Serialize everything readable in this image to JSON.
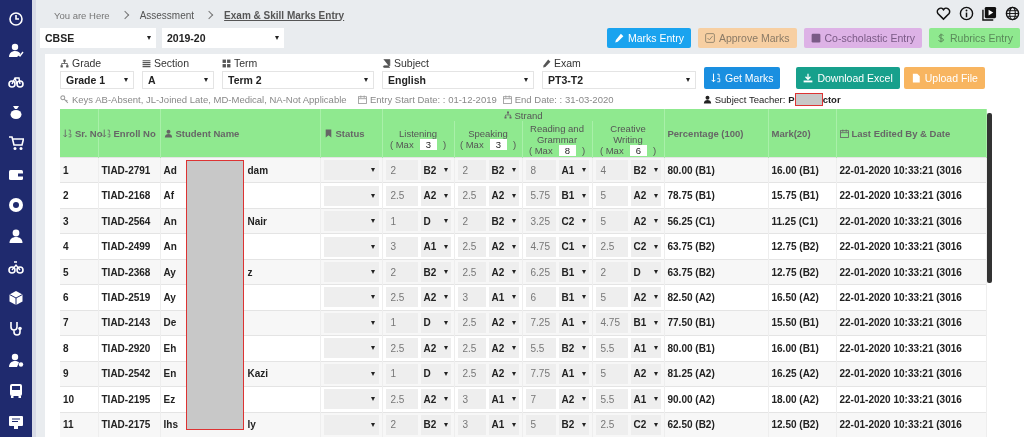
{
  "breadcrumb": {
    "prefix": "You are Here",
    "items": [
      "Assessment",
      "Exam & Skill Marks Entry"
    ]
  },
  "board_select": {
    "value": "CBSE"
  },
  "year_select": {
    "value": "2019-20"
  },
  "action_buttons": [
    {
      "label": "Marks Entry",
      "kind": "primary"
    },
    {
      "label": "Approve Marks",
      "kind": "approve"
    },
    {
      "label": "Co-scholastic Entry",
      "kind": "coscholastic"
    },
    {
      "label": "Rubrics Entry",
      "kind": "rubrics"
    }
  ],
  "filters": [
    {
      "label": "Grade",
      "value": "Grade 1"
    },
    {
      "label": "Section",
      "value": "A"
    },
    {
      "label": "Term",
      "value": "Term 2"
    },
    {
      "label": "Subject",
      "value": "English"
    },
    {
      "label": "Exam",
      "value": "PT3-T2"
    }
  ],
  "form_buttons": [
    {
      "label": "Get Marks",
      "kind": "get"
    },
    {
      "label": "Download Excel",
      "kind": "download"
    },
    {
      "label": "Upload File",
      "kind": "upload"
    }
  ],
  "keys_note": "Keys AB-Absent, JL-Joined Late, MD-Medical, NA-Not Applicable",
  "entry_start": "Entry Start Date: : 01-12-2019",
  "end_date": "End Date: : 31-03-2020",
  "subject_teacher": {
    "label": "Subject Teacher:",
    "name_start": "P",
    "name_end": "ctor"
  },
  "table": {
    "columns": [
      "Sr. No",
      "Enroll No",
      "Student Name",
      "Status",
      "Percentage (100)",
      "Mark(20)",
      "Last Edited By & Date"
    ],
    "strand": {
      "label": "Strand",
      "skills": [
        {
          "label": "Listening",
          "max_prefix": "( Max",
          "max": "3",
          "max_suffix": ")"
        },
        {
          "label": "Speaking",
          "max_prefix": "( Max",
          "max": "3",
          "max_suffix": ")"
        },
        {
          "label": "Reading and Grammar",
          "max_prefix": "( Max",
          "max": "8",
          "max_suffix": ")"
        },
        {
          "label": "Creative Writing",
          "max_prefix": "( Max",
          "max": "6",
          "max_suffix": ")"
        }
      ]
    },
    "rows": [
      {
        "sr": "1",
        "enroll": "TIAD-2791",
        "name_start": "Ad",
        "name_end": "dam",
        "scores": [
          [
            "2",
            "B2"
          ],
          [
            "2",
            "B2"
          ],
          [
            "8",
            "A1"
          ],
          [
            "4",
            "B2"
          ]
        ],
        "percentage": "80.00 (B1)",
        "mark": "16.00 (B1)",
        "edited": "22-01-2020 10:33:21 (3016"
      },
      {
        "sr": "2",
        "enroll": "TIAD-2168",
        "name_start": "Af",
        "name_end": "",
        "scores": [
          [
            "2.5",
            "A2"
          ],
          [
            "2.5",
            "A2"
          ],
          [
            "5.75",
            "B1"
          ],
          [
            "5",
            "A2"
          ]
        ],
        "percentage": "78.75 (B1)",
        "mark": "15.75 (B1)",
        "edited": "22-01-2020 10:33:21 (3016"
      },
      {
        "sr": "3",
        "enroll": "TIAD-2564",
        "name_start": "An",
        "name_end": "Nair",
        "scores": [
          [
            "1",
            "D"
          ],
          [
            "2",
            "B2"
          ],
          [
            "3.25",
            "C2"
          ],
          [
            "5",
            "A2"
          ]
        ],
        "percentage": "56.25 (C1)",
        "mark": "11.25 (C1)",
        "edited": "22-01-2020 10:33:21 (3016"
      },
      {
        "sr": "4",
        "enroll": "TIAD-2499",
        "name_start": "An",
        "name_end": "",
        "scores": [
          [
            "3",
            "A1"
          ],
          [
            "2.5",
            "A2"
          ],
          [
            "4.75",
            "C1"
          ],
          [
            "2.5",
            "C2"
          ]
        ],
        "percentage": "63.75 (B2)",
        "mark": "12.75 (B2)",
        "edited": "22-01-2020 10:33:21 (3016"
      },
      {
        "sr": "5",
        "enroll": "TIAD-2368",
        "name_start": "Ay",
        "name_end": "z",
        "scores": [
          [
            "2",
            "B2"
          ],
          [
            "2.5",
            "A2"
          ],
          [
            "6.25",
            "B1"
          ],
          [
            "2",
            "D"
          ]
        ],
        "percentage": "63.75 (B2)",
        "mark": "12.75 (B2)",
        "edited": "22-01-2020 10:33:21 (3016"
      },
      {
        "sr": "6",
        "enroll": "TIAD-2519",
        "name_start": "Ay",
        "name_end": "",
        "scores": [
          [
            "2.5",
            "A2"
          ],
          [
            "3",
            "A1"
          ],
          [
            "6",
            "B1"
          ],
          [
            "5",
            "A2"
          ]
        ],
        "percentage": "82.50 (A2)",
        "mark": "16.50 (A2)",
        "edited": "22-01-2020 10:33:21 (3016"
      },
      {
        "sr": "7",
        "enroll": "TIAD-2143",
        "name_start": "De",
        "name_end": "",
        "scores": [
          [
            "1",
            "D"
          ],
          [
            "2.5",
            "A2"
          ],
          [
            "7.25",
            "A1"
          ],
          [
            "4.75",
            "B1"
          ]
        ],
        "percentage": "77.50 (B1)",
        "mark": "15.50 (B1)",
        "edited": "22-01-2020 10:33:21 (3016"
      },
      {
        "sr": "8",
        "enroll": "TIAD-2920",
        "name_start": "Eh",
        "name_end": "",
        "scores": [
          [
            "2.5",
            "A2"
          ],
          [
            "2.5",
            "A2"
          ],
          [
            "5.5",
            "B2"
          ],
          [
            "5.5",
            "A1"
          ]
        ],
        "percentage": "80.00 (B1)",
        "mark": "16.00 (B1)",
        "edited": "22-01-2020 10:33:21 (3016"
      },
      {
        "sr": "9",
        "enroll": "TIAD-2542",
        "name_start": "En",
        "name_end": "Kazi",
        "scores": [
          [
            "1",
            "D"
          ],
          [
            "2.5",
            "A2"
          ],
          [
            "7.75",
            "A1"
          ],
          [
            "5",
            "A2"
          ]
        ],
        "percentage": "81.25 (A2)",
        "mark": "16.25 (A2)",
        "edited": "22-01-2020 10:33:21 (3016"
      },
      {
        "sr": "10",
        "enroll": "TIAD-2195",
        "name_start": "Ez",
        "name_end": "",
        "scores": [
          [
            "2.5",
            "A2"
          ],
          [
            "3",
            "A1"
          ],
          [
            "7",
            "A2"
          ],
          [
            "5.5",
            "A1"
          ]
        ],
        "percentage": "90.00 (A2)",
        "mark": "18.00 (A2)",
        "edited": "22-01-2020 10:33:21 (3016"
      },
      {
        "sr": "11",
        "enroll": "TIAD-2175",
        "name_start": "Ihs",
        "name_end": "ly",
        "scores": [
          [
            "2",
            "B2"
          ],
          [
            "3",
            "A1"
          ],
          [
            "5",
            "B2"
          ],
          [
            "2.5",
            "C2"
          ]
        ],
        "percentage": "62.50 (B2)",
        "mark": "12.50 (B2)",
        "edited": "22-01-2020 10:33:21 (3016"
      }
    ]
  }
}
